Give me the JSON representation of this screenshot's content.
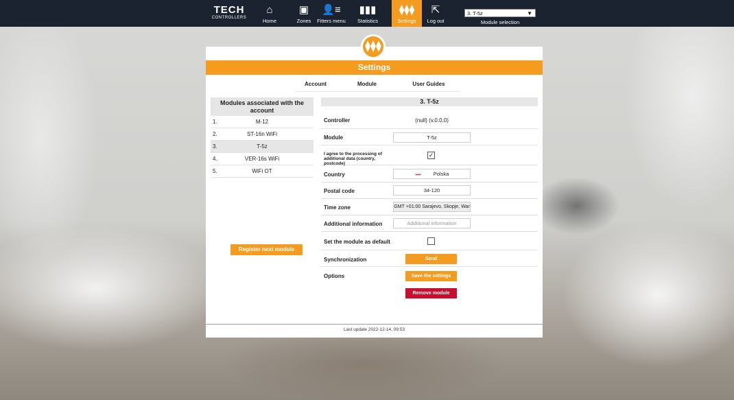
{
  "nav": {
    "logo_main": "TECH",
    "logo_sub": "CONTROLLERS",
    "items": [
      {
        "label": "Home",
        "icon": "home-icon"
      },
      {
        "label": "Zones",
        "icon": "zones-icon"
      },
      {
        "label": "Fitters menu",
        "icon": "fitters-menu-icon"
      },
      {
        "label": "Statistics",
        "icon": "statistics-icon"
      },
      {
        "label": "Settings",
        "icon": "settings-sliders-icon"
      },
      {
        "label": "Log out",
        "icon": "logout-icon"
      }
    ],
    "module_select_value": "3. T-5z",
    "module_select_label": "Module selection"
  },
  "colors": {
    "accent": "#f39c1f",
    "danger": "#c8102e",
    "topbar": "#1c2330"
  },
  "panel": {
    "title": "Settings",
    "tabs": [
      "Account",
      "Module",
      "User Guides"
    ],
    "active_tab": "Module"
  },
  "modules": {
    "title": "Modules associated with the account",
    "items": [
      {
        "num": "1.",
        "name": "M-12"
      },
      {
        "num": "2.",
        "name": "ST-16n WiFi"
      },
      {
        "num": "3.",
        "name": "T-5z"
      },
      {
        "num": "4.",
        "name": "VER-16s WiFi"
      },
      {
        "num": "5.",
        "name": "WiFi OT"
      }
    ],
    "register_button": "Register next module"
  },
  "form": {
    "title": "3. T-5z",
    "controller_label": "Controller",
    "controller_value": "(null) (v.0.0.0)",
    "module_label": "Module",
    "module_value": "T-5z",
    "agree_label": "I agree to the processing of additional data (country, postcode)",
    "agree_checked": true,
    "country_label": "Country",
    "country_value": "Polska",
    "postal_label": "Postal code",
    "postal_value": "34-120",
    "timezone_label": "Time zone",
    "timezone_value": "GMT +01:00 Sarajevo, Skopje, War",
    "additional_label": "Additional information",
    "additional_placeholder": "Additional information",
    "default_label": "Set the module as default",
    "default_checked": false,
    "sync_label": "Synchronization",
    "send_button": "Send",
    "options_label": "Options",
    "save_button": "Save the settings",
    "remove_button": "Remove module"
  },
  "footer": {
    "last_update": "Last update 2022-12-14, 09:53"
  }
}
